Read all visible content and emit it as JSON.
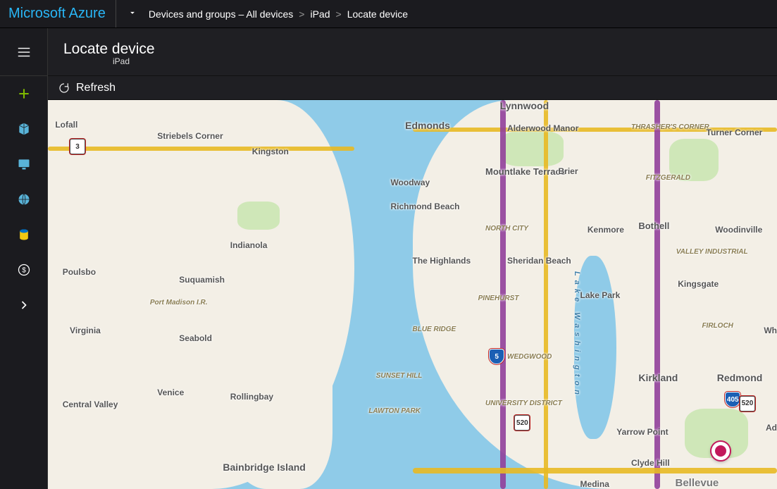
{
  "brand": "Microsoft Azure",
  "breadcrumb": {
    "items": [
      "Devices and groups – All devices",
      "iPad",
      "Locate device"
    ]
  },
  "blade": {
    "title": "Locate device",
    "subtitle": "iPad",
    "cmd_refresh": "Refresh"
  },
  "sidebar": {
    "items": [
      {
        "name": "add",
        "color": "#7fba00"
      },
      {
        "name": "cube",
        "color": "#59b4d9"
      },
      {
        "name": "monitor",
        "color": "#59b4d9"
      },
      {
        "name": "globe",
        "color": "#59b4d9"
      },
      {
        "name": "sql",
        "color": "#f2c811"
      },
      {
        "name": "billing",
        "color": "#ffffff"
      },
      {
        "name": "more",
        "color": "#ffffff"
      }
    ]
  },
  "map": {
    "labels": {
      "lofall": "Lofall",
      "striebels": "Striebels\nCorner",
      "kingston": "Kingston",
      "poulsbo": "Poulsbo",
      "suquamish": "Suquamish",
      "portmadison": "Port\nMadison\nI.R.",
      "virginia": "Virginia",
      "seabold": "Seabold",
      "venice": "Venice",
      "rollingbay": "Rollingbay",
      "centralvalley": "Central\nValley",
      "bainbridge": "Bainbridge\nIsland",
      "indianola": "Indianola",
      "edmonds": "Edmonds",
      "lynnwood": "Lynnwood",
      "alderwood": "Alderwood Manor",
      "thrashers": "THRASHER'S\nCORNER",
      "turner": "Turner\nCorner",
      "mountlake": "Mountlake\nTerrace",
      "brier": "Brier",
      "fitzgerald": "FITZGERALD",
      "woodway": "Woodway",
      "richmond": "Richmond Beach",
      "northcity": "NORTH CITY",
      "kenmore": "Kenmore",
      "bothell": "Bothell",
      "woodinville": "Woodinville",
      "valleyind": "VALLEY INDUSTRIAL",
      "highlands": "The Highlands",
      "sheridan": "Sheridan Beach",
      "lakepark": "Lake Park",
      "kingsgate": "Kingsgate",
      "pinehurst": "PINEHURST",
      "firloch": "FIRLOCH",
      "blueridge": "BLUE RIDGE",
      "wedgwood": "WEDGWOOD",
      "sunsethill": "SUNSET HILL",
      "lawton": "LAWTON PARK",
      "univdist": "UNIVERSITY\nDISTRICT",
      "kirkland": "Kirkland",
      "redmond": "Redmond",
      "yarrow": "Yarrow Point",
      "clydehill": "Clyde Hill",
      "medina": "Medina",
      "wh": "Wh",
      "bellevue": "Bellevue",
      "ad": "Ad",
      "lakewash": "Lake Washington"
    },
    "shields": {
      "i5": "5",
      "i405": "405",
      "sr3": "3",
      "sr520a": "520",
      "sr520b": "520"
    },
    "marker": {
      "name": "device-location",
      "color": "#c2185b"
    }
  }
}
